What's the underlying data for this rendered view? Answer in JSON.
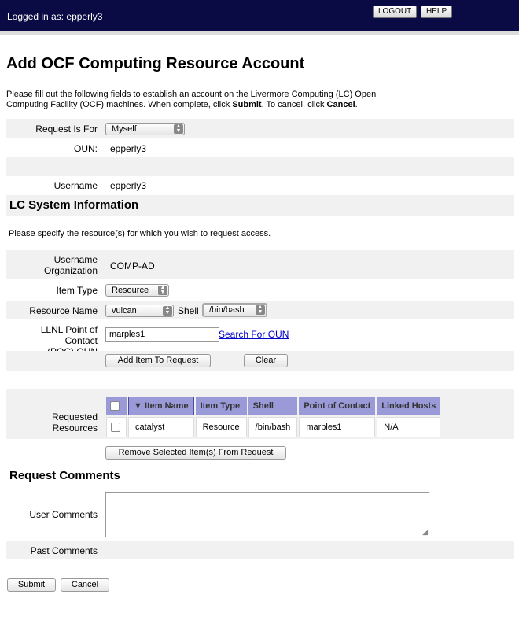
{
  "header": {
    "logged_in": "Logged in as: epperly3",
    "logout": "LOGOUT",
    "help": "HELP"
  },
  "page": {
    "title": "Add OCF Computing Resource Account",
    "intro_1": "Please fill out the following fields to establish an account on the Livermore Computing (LC) Open",
    "intro_2a": "Computing Facility (OCF) machines. When complete, click ",
    "intro_submit": "Submit",
    "intro_2b": ". To cancel, click ",
    "intro_cancel": "Cancel",
    "intro_2c": "."
  },
  "form": {
    "request_for_label": "Request Is For",
    "request_for_value": "Myself",
    "oun_label": "OUN:",
    "oun_value": "epperly3",
    "username_label": "Username",
    "username_value": "epperly3"
  },
  "lc": {
    "section_title": "LC System Information",
    "instructions": "Please specify the resource(s) for which you wish to request access.",
    "org_label_1": "Username",
    "org_label_2": "Organization",
    "org_value": "COMP-AD",
    "item_type_label": "Item Type",
    "item_type_value": "Resource",
    "resource_name_label": "Resource Name",
    "resource_name_value": "vulcan",
    "shell_label": "Shell",
    "shell_value": "/bin/bash",
    "poc_label_1": "LLNL Point of Contact",
    "poc_label_2": "(POC) OUN",
    "poc_value": "marples1",
    "search_oun": "Search For OUN",
    "add_item": "Add Item To Request",
    "clear": "Clear"
  },
  "requested": {
    "label": "Requested Resources",
    "columns": [
      "▼ Item Name",
      "Item Type",
      "Shell",
      "Point of Contact",
      "Linked Hosts"
    ],
    "rows": [
      {
        "item_name": "catalyst",
        "item_type": "Resource",
        "shell": "/bin/bash",
        "poc": "marples1",
        "linked_hosts": "N/A"
      }
    ],
    "remove_button": "Remove Selected Item(s) From Request"
  },
  "comments": {
    "section_title": "Request Comments",
    "user_comments_label": "User Comments",
    "past_comments_label": "Past Comments"
  },
  "footer": {
    "submit": "Submit",
    "cancel": "Cancel"
  },
  "colors": {
    "header_bg": "#0a0a45",
    "table_header_bg": "#9a9ad8",
    "row_bg": "#f1f1f1",
    "link": "#0000cc"
  }
}
